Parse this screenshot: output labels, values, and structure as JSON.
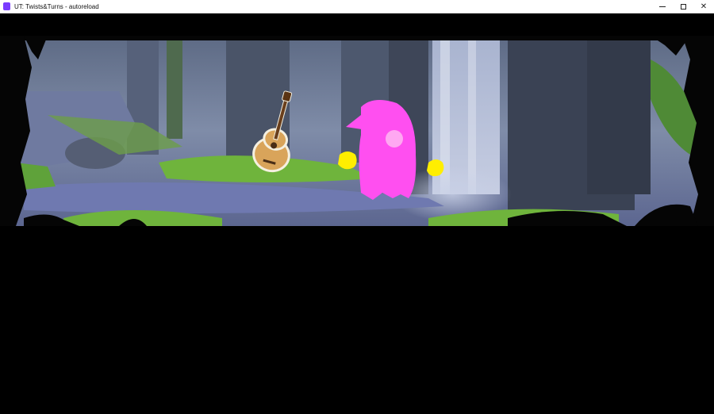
{
  "window": {
    "title": "UT: Twists&Turns - autoreload",
    "icon": "app-icon",
    "accent_color": "#7a3cff",
    "controls": {
      "minimize_icon": "minimize-icon",
      "maximize_icon": "maximize-icon",
      "close_glyph": "✕"
    }
  },
  "scene": {
    "setting": "forest-waterfall",
    "objects": [
      {
        "name": "acoustic-guitar",
        "icon": "guitar-sprite"
      },
      {
        "name": "player-character",
        "icon": "pink-blob-sprite",
        "color": "#ff4ff0"
      },
      {
        "name": "left-hand",
        "icon": "yellow-hand-sprite",
        "color": "#ffee00"
      },
      {
        "name": "right-hand",
        "icon": "yellow-hand-sprite",
        "color": "#ffee00"
      }
    ],
    "colors": {
      "sky_mist": "#9aa6c6",
      "water": "#6f79b0",
      "grass": "#6fb43c",
      "waterfall": "#b8c2dc",
      "silhouette": "#050505"
    }
  }
}
